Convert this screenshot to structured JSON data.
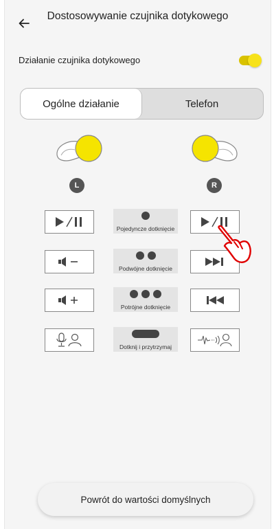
{
  "header": {
    "title": "Dostosowywanie czujnika dotykowego",
    "back_icon": "arrow-left-icon"
  },
  "touch_sensor": {
    "label": "Działanie czujnika dotykowego",
    "enabled": true,
    "accent_color": "#f7e21a"
  },
  "tabs": [
    {
      "label": "Ogólne działanie",
      "active": true
    },
    {
      "label": "Telefon",
      "active": false
    }
  ],
  "earbuds": {
    "left_badge": "L",
    "right_badge": "R",
    "highlight_color": "#f5e400"
  },
  "gestures": [
    {
      "label": "Pojedyncze dotknięcie",
      "left_action": "play-pause-icon",
      "right_action": "play-pause-icon"
    },
    {
      "label": "Podwójne dotknięcie",
      "left_action": "volume-down-icon",
      "right_action": "next-track-icon"
    },
    {
      "label": "Potrójne dotknięcie",
      "left_action": "volume-up-icon",
      "right_action": "previous-track-icon"
    },
    {
      "label": "Dotknij i przytrzymaj",
      "left_action": "voice-assistant-icon",
      "right_action": "ambient-sound-icon"
    }
  ],
  "reset_button": {
    "label": "Powrót do wartości domyślnych"
  }
}
